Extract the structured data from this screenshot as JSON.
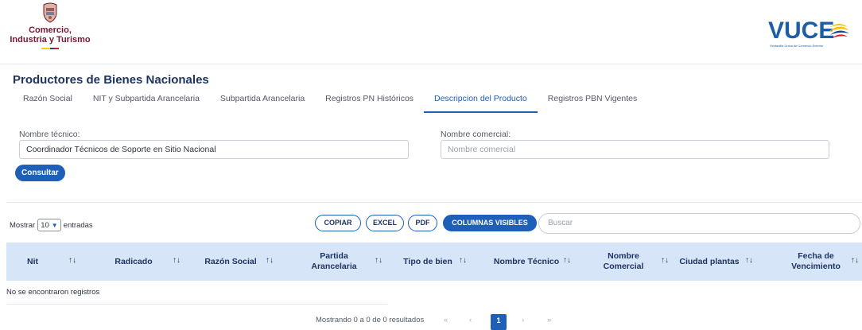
{
  "header": {
    "logo_left_line1": "Comercio,",
    "logo_left_line2": "Industria y Turismo",
    "logo_right_text": "VUCE",
    "logo_right_subtext": "Ventanilla Única de Comercio Exterior"
  },
  "page": {
    "title": "Productores de Bienes Nacionales"
  },
  "tabs": [
    {
      "label": "Razón Social",
      "active": false
    },
    {
      "label": "NIT y Subpartida Arancelaria",
      "active": false
    },
    {
      "label": "Subpartida Arancelaria",
      "active": false
    },
    {
      "label": "Registros PN Históricos",
      "active": false
    },
    {
      "label": "Descripcion del Producto",
      "active": true
    },
    {
      "label": "Registros PBN Vigentes",
      "active": false
    }
  ],
  "form": {
    "nombre_tecnico": {
      "label": "Nombre técnico:",
      "value": "Coordinador Técnicos de Soporte en Sitio Nacional"
    },
    "nombre_comercial": {
      "label": "Nombre comercial:",
      "placeholder": "Nombre comercial"
    },
    "consultar_label": "Consultar"
  },
  "table_controls": {
    "mostrar_label": "Mostrar",
    "entries_value": "10",
    "entradas_label": "entradas",
    "buttons": [
      "COPIAR",
      "EXCEL",
      "PDF",
      "COLUMNAS VISIBLES"
    ],
    "search_placeholder": "Buscar"
  },
  "table": {
    "columns": [
      {
        "label": "Nit"
      },
      {
        "label": "Radicado"
      },
      {
        "label": "Razón Social"
      },
      {
        "label": "Partida Arancelaria"
      },
      {
        "label": "Tipo de bien"
      },
      {
        "label": "Nombre Técnico"
      },
      {
        "label": "Nombre Comercial"
      },
      {
        "label": "Ciudad plantas"
      },
      {
        "label": "Fecha de Vencimiento"
      }
    ],
    "sort_icon": "↑↓",
    "empty_message": "No se encontraron registros"
  },
  "pagination": {
    "summary": "Mostrando 0 a 0 de 0 resultados",
    "first": "«",
    "prev": "‹",
    "current": "1",
    "next": "›",
    "last": "»"
  },
  "colors": {
    "primary": "#1e5fb8",
    "header_bg": "#d6e5f8",
    "title": "#1e3461"
  },
  "icons": {
    "sort": "sort-arrows-icon",
    "select_chevron": "chevron-down-icon"
  }
}
